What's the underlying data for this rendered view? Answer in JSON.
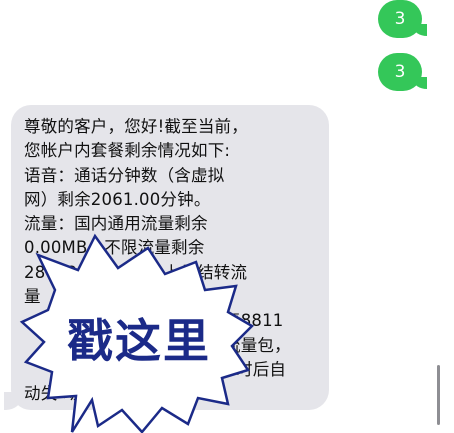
{
  "conversation": {
    "sent_messages": [
      {
        "text": "3"
      },
      {
        "text": "3"
      }
    ],
    "received_message": {
      "lines": [
        "尊敬的客户，您好!截至当前，",
        "您帐户内套餐剩余情况如下:",
        "语音：通话分钟数（含虚拟",
        "网）剩余2061.00分钟。",
        "流量：国内通用流量剩余",
        "0.00MB。不限流量剩余",
        "28712.85MB（含上月结转流",
        "量",
        "复8811",
        "流量包，",
        "时后自",
        "动失      动】"
      ]
    }
  },
  "overlay": {
    "label": "戳这里",
    "fill_color": "#ffffff",
    "stroke_color": "#1b2a88"
  },
  "colors": {
    "sent_bubble": "#34c759",
    "received_bubble": "#e5e5ea"
  }
}
